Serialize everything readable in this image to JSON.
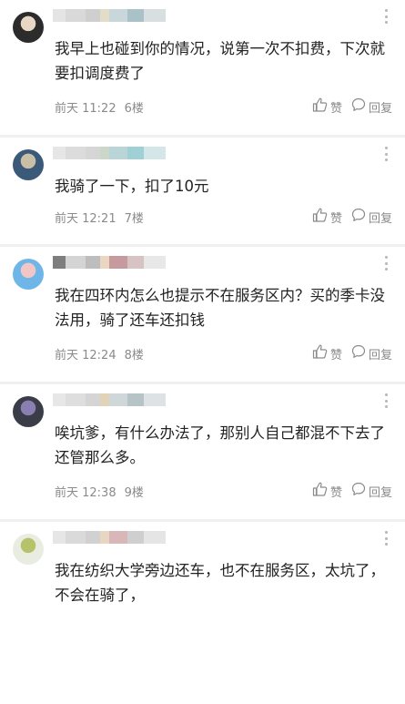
{
  "comments": [
    {
      "text": "我早上也碰到你的情况，说第一次不扣费，下次就要扣调度费了",
      "time": "前天 11:22",
      "floor": "6楼",
      "like_label": "赞",
      "reply_label": "回复",
      "avatar_colors": [
        "#2c2c2c",
        "#e8d7c4"
      ],
      "name_colors": [
        "#e4e4e4",
        "#d9d9d9",
        "#cfcfcf",
        "#e3dcc7",
        "#c9d6da",
        "#a9c1c7",
        "#d7dfe1"
      ]
    },
    {
      "text": "我骑了一下，扣了10元",
      "time": "前天 12:21",
      "floor": "7楼",
      "like_label": "赞",
      "reply_label": "回复",
      "avatar_colors": [
        "#3b5a7a",
        "#c9bfa6"
      ],
      "name_colors": [
        "#e6e6e6",
        "#dcdcdc",
        "#d6d6d6",
        "#cbd8c9",
        "#b9d5d8",
        "#9fd0d6",
        "#d5e6e8"
      ]
    },
    {
      "text": "我在四环内怎么也提示不在服务区内？买的季卡没法用，骑了还车还扣钱",
      "time": "前天 12:24",
      "floor": "8楼",
      "like_label": "赞",
      "reply_label": "回复",
      "avatar_colors": [
        "#6fb6e8",
        "#f3c6c6"
      ],
      "name_colors": [
        "#7e7e7e",
        "#d4d4d4",
        "#bdbdbd",
        "#ead7c2",
        "#c69a9e",
        "#d8c3c4",
        "#e8e8e8"
      ]
    },
    {
      "text": "唉坑爹，有什么办法了，那别人自己都混不下去了还管那么多。",
      "time": "前天 12:38",
      "floor": "9楼",
      "like_label": "赞",
      "reply_label": "回复",
      "avatar_colors": [
        "#3a3d47",
        "#8a7fb0"
      ],
      "name_colors": [
        "#e7e7e7",
        "#dedede",
        "#d5d5d5",
        "#e2d3b8",
        "#cfd7d9",
        "#b7c4c7",
        "#dde3e4"
      ]
    },
    {
      "text": "我在纺织大学旁边还车，也不在服务区，太坑了，不会在骑了，",
      "time": "",
      "floor": "",
      "like_label": "",
      "reply_label": "",
      "avatar_colors": [
        "#e9ece0",
        "#b7c36a"
      ],
      "name_colors": [
        "#e6e6e6",
        "#dadada",
        "#d1d1d1",
        "#e6d6c2",
        "#d9b7b9",
        "#cfcfcf",
        "#e5e5e5"
      ]
    }
  ]
}
